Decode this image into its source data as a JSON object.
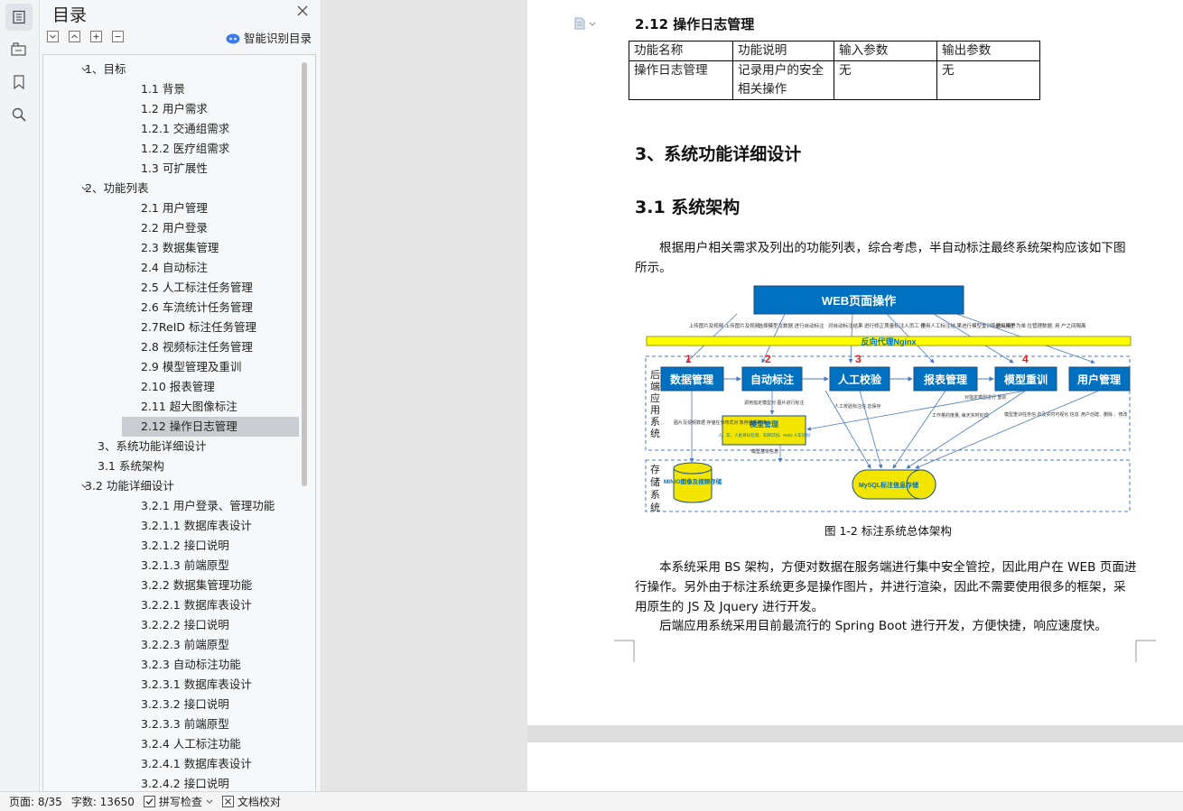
{
  "toc": {
    "title": "目录",
    "smart_label": "智能识别目录",
    "items": [
      {
        "label": "1、目标",
        "level": 1,
        "expanded": true
      },
      {
        "label": "1.1  背景",
        "level": 3
      },
      {
        "label": "1.2  用户需求",
        "level": 3
      },
      {
        "label": "1.2.1  交通组需求",
        "level": 3
      },
      {
        "label": "1.2.2  医疗组需求",
        "level": 3
      },
      {
        "label": "1.3  可扩展性",
        "level": 3
      },
      {
        "label": "2、功能列表",
        "level": 1,
        "expanded": true
      },
      {
        "label": "2.1 用户管理",
        "level": 3
      },
      {
        "label": "2.2 用户登录",
        "level": 3
      },
      {
        "label": "2.3 数据集管理",
        "level": 3
      },
      {
        "label": "2.4 自动标注",
        "level": 3
      },
      {
        "label": "2.5 人工标注任务管理",
        "level": 3
      },
      {
        "label": "2.6 车流统计任务管理",
        "level": 3
      },
      {
        "label": "2.7ReID 标注任务管理",
        "level": 3
      },
      {
        "label": "2.8 视频标注任务管理",
        "level": 3
      },
      {
        "label": "2.9 模型管理及重训",
        "level": 3
      },
      {
        "label": "2.10 报表管理",
        "level": 3
      },
      {
        "label": "2.11 超大图像标注",
        "level": 3
      },
      {
        "label": "2.12 操作日志管理",
        "level": 3,
        "selected": true
      },
      {
        "label": "3、系统功能详细设计",
        "level": 2
      },
      {
        "label": "3.1 系统架构",
        "level": 2
      },
      {
        "label": "3.2 功能详细设计",
        "level": 1,
        "expanded": true
      },
      {
        "label": "3.2.1  用户登录、管理功能",
        "level": 3
      },
      {
        "label": "3.2.1.1  数据库表设计",
        "level": 3
      },
      {
        "label": "3.2.1.2  接口说明",
        "level": 3
      },
      {
        "label": "3.2.1.3  前端原型",
        "level": 3
      },
      {
        "label": "3.2.2  数据集管理功能",
        "level": 3
      },
      {
        "label": "3.2.2.1  数据库表设计",
        "level": 3
      },
      {
        "label": "3.2.2.2  接口说明",
        "level": 3
      },
      {
        "label": "3.2.2.3  前端原型",
        "level": 3
      },
      {
        "label": "3.2.3  自动标注功能",
        "level": 3
      },
      {
        "label": "3.2.3.1  数据库表设计",
        "level": 3
      },
      {
        "label": "3.2.3.2  接口说明",
        "level": 3
      },
      {
        "label": "3.2.3.3  前端原型",
        "level": 3
      },
      {
        "label": "3.2.4  人工标注功能",
        "level": 3
      },
      {
        "label": "3.2.4.1  数据库表设计",
        "level": 3
      },
      {
        "label": "3.2.4.2  接口说明",
        "level": 3
      }
    ]
  },
  "doc": {
    "h_212": "2.12 操作日志管理",
    "table": {
      "headers": [
        "功能名称",
        "功能说明",
        "输入参数",
        "输出参数"
      ],
      "row": [
        "操作日志管理",
        "记录用户的安全",
        "无",
        "无"
      ],
      "row_cont": "相关操作"
    },
    "h_3": "3、系统功能详细设计",
    "h_31": "3.1 系统架构",
    "para1_a": "根据用户相关需求及列出的功能列表，综合考虑，半自动标注最终系统架构应该如下图",
    "para1_b": "所示。",
    "caption": "图 1-2 标注系统总体架构",
    "para2_a": "本系统采用 BS 架构，方便对数据在服务端进行集中安全管控，因此用户在 WEB 页面进",
    "para2_b": "行操作。另外由于标注系统更多是操作图片，并进行渲染，因此不需要使用很多的框架，采",
    "para2_c": "用原生的 JS 及 Jquery 进行开发。",
    "para3": "后端应用系统采用目前最流行的 Spring Boot 进行开发，方便快捷，响应速度快。"
  },
  "diagram": {
    "web": "WEB页面操作",
    "nginx": "反向代理Nginx",
    "backend_label": "后端应用系统",
    "storage_label": "存储系统",
    "modules": [
      "数据管理",
      "自动标注",
      "人工校验",
      "报表管理",
      "模型重训",
      "用户管理"
    ],
    "numbers": [
      "1",
      "2",
      "3",
      "4"
    ],
    "top_notes": [
      "上传图片及视频 上传图片及视频",
      "选择模型及数据 进行自动标注",
      "对自动标注结果 进行修正",
      "质量标注人员工 作",
      "使用人工标注结 果进行模型重训 , 便用模型",
      "系统以用户为单 位管理数据, 用 户之间隔离"
    ],
    "model_box": "模型管理",
    "model_sub": "人、车、人脸目标检测、车牌识别、ReID 人车识别",
    "task_label": "模型基本信息",
    "minio": "MINIO图像及视频存储",
    "mysql": "MySQL标注信息存储",
    "notes": [
      "图片及视频数据 存储在分布式对 象存储系统中",
      "调用指定模型对 图片进行标注",
      "人工校验标注信 息保存",
      "工作量的度量, 每天实时处理",
      "对指定模型进行 重训",
      "模型重训任务信 息及实时可视化 信息",
      "用户创建、删除 、修改"
    ]
  },
  "status": {
    "page": "页面: 8/35",
    "words": "字数: 13650",
    "spell": "拼写检查",
    "proof": "文档校对"
  },
  "colors": {
    "accent": "#0070c0",
    "nginx": "#ffff00",
    "storage": "#f2e600"
  }
}
